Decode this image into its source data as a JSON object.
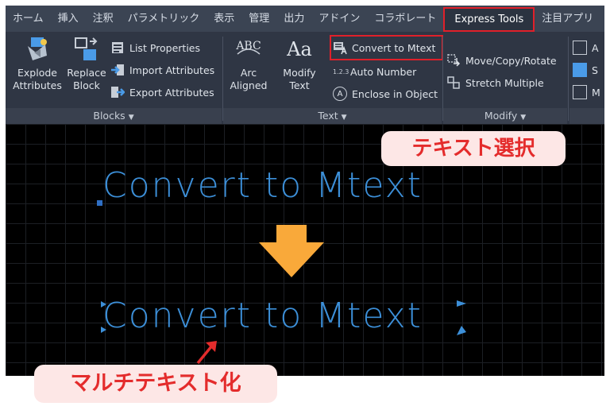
{
  "tabs": [
    {
      "label": "ホーム"
    },
    {
      "label": "挿入"
    },
    {
      "label": "注釈"
    },
    {
      "label": "パラメトリック"
    },
    {
      "label": "表示"
    },
    {
      "label": "管理"
    },
    {
      "label": "出力"
    },
    {
      "label": "アドイン"
    },
    {
      "label": "コラボレート"
    },
    {
      "label": "Express Tools",
      "active": true
    },
    {
      "label": "注目アプリ"
    }
  ],
  "ribbon": {
    "blocks": {
      "title": "Blocks",
      "explode_line1": "Explode",
      "explode_line2": "Attributes",
      "replace_line1": "Replace",
      "replace_line2": "Block",
      "list_properties": "List Properties",
      "import_attributes": "Import Attributes",
      "export_attributes": "Export Attributes"
    },
    "text": {
      "title": "Text",
      "arc_line1": "Arc",
      "arc_line2": "Aligned",
      "arc_icon_letters": "ABC",
      "modify_line1": "Modify",
      "modify_line2": "Text",
      "modify_icon_letters": "Aa",
      "convert_to_mtext": "Convert to Mtext",
      "auto_number_prefix": "1.2.3",
      "auto_number": "Auto Number",
      "enclose_in_object": "Enclose in Object",
      "enclose_icon_letter": "A"
    },
    "modify": {
      "title": "Modify",
      "move_copy_rotate": "Move/Copy/Rotate",
      "stretch_multiple": "Stretch Multiple"
    },
    "partial": {
      "item1": "A",
      "item2": "S",
      "item3": "M"
    }
  },
  "canvas": {
    "text_before": "Convert to Mtext",
    "text_after": "Convert to Mtext",
    "callout_top": "テキスト選択",
    "callout_bottom": "マルチテキスト化"
  },
  "colors": {
    "highlight_red": "#e0202a",
    "cad_text_blue": "#3c8fd8",
    "arrow_orange": "#f9a93a",
    "callout_bg": "#fde7e6",
    "callout_text": "#e42c2c"
  }
}
